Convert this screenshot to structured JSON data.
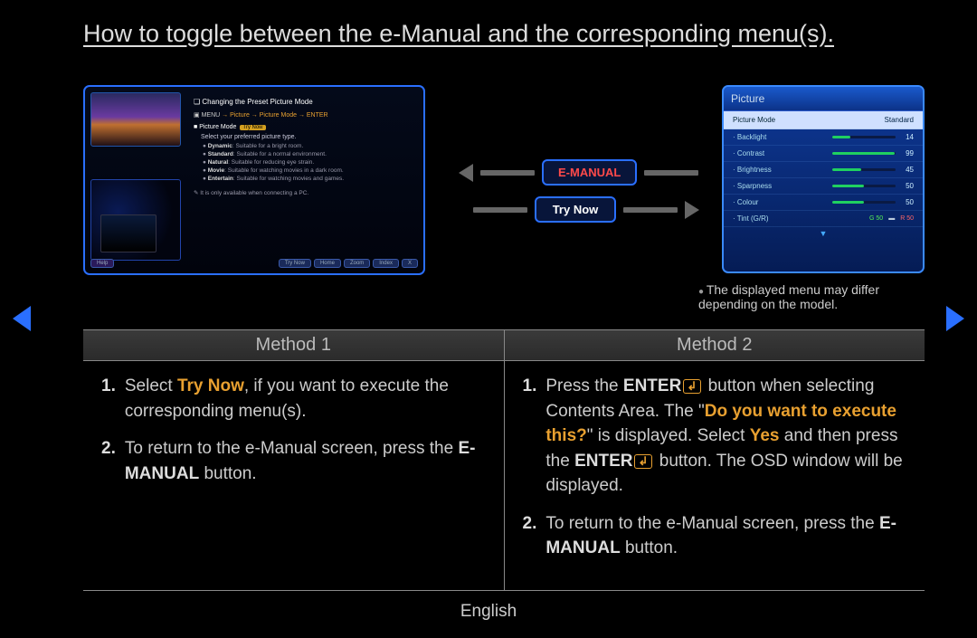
{
  "title": "How to toggle between the e-Manual and the corresponding menu(s).",
  "footer_language": "English",
  "center_buttons": {
    "emanual_label": "E-MANUAL",
    "trynow_label": "Try Now"
  },
  "emanual_preview": {
    "heading": "Changing the Preset Picture Mode",
    "path_prefix": "MENU",
    "path_rest": " → Picture → Picture Mode → ENTER",
    "subheading": "Picture Mode",
    "trynow_badge": "Try Now",
    "description": "Select your preferred picture type.",
    "bullets": [
      {
        "name": "Dynamic",
        "desc": ": Suitable for a bright room."
      },
      {
        "name": "Standard",
        "desc": ": Suitable for a normal environment."
      },
      {
        "name": "Natural",
        "desc": ": Suitable for reducing eye strain."
      },
      {
        "name": "Movie",
        "desc": ": Suitable for watching movies in a dark room."
      },
      {
        "name": "Entertain",
        "desc": ": Suitable for watching movies and games."
      }
    ],
    "note": "It is only available when connecting a PC.",
    "toolbar": {
      "help": "Help",
      "trynow": "Try Now",
      "home": "Home",
      "zoom": "Zoom",
      "index": "Index",
      "close": "X"
    }
  },
  "picture_menu": {
    "title": "Picture",
    "mode_label": "Picture Mode",
    "mode_value": "Standard",
    "note": "The displayed menu may differ depending on the model.",
    "items": [
      {
        "label": "Backlight",
        "value": "14",
        "fill": 28
      },
      {
        "label": "Contrast",
        "value": "99",
        "fill": 99
      },
      {
        "label": "Brightness",
        "value": "45",
        "fill": 45
      },
      {
        "label": "Sparpness",
        "value": "50",
        "fill": 50
      },
      {
        "label": "Colour",
        "value": "50",
        "fill": 50
      }
    ],
    "tint": {
      "label": "Tint (G/R)",
      "g": "G 50",
      "r": "R 50"
    }
  },
  "methods": {
    "header1": "Method 1",
    "header2": "Method 2",
    "m1": {
      "s1_a": "Select ",
      "s1_try": "Try Now",
      "s1_b": ", if you want to execute the corresponding menu(s).",
      "s2_a": "To return to the e-Manual screen, press the ",
      "s2_btn": "E-MANUAL",
      "s2_b": " button."
    },
    "m2": {
      "s1_a": "Press the ",
      "s1_enter": "ENTER",
      "s1_b": " button when selecting Contents Area. The \"",
      "s1_prompt": "Do you want to execute this?",
      "s1_c": "\" is displayed. Select ",
      "s1_yes": "Yes",
      "s1_d": " and then press the ",
      "s1_enter2": "ENTER",
      "s1_e": " button. The OSD window will be displayed.",
      "s2_a": "To return to the e-Manual screen, press the ",
      "s2_btn": "E-MANUAL",
      "s2_b": " button."
    }
  }
}
